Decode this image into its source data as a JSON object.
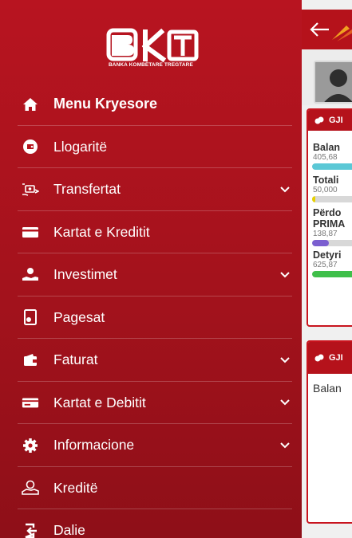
{
  "brand": {
    "caption": "BANKA KOMBËTARE TREGTARE"
  },
  "menu": {
    "items": [
      {
        "label": "Menu Kryesore",
        "icon": "home-icon",
        "expandable": false
      },
      {
        "label": "Llogaritë",
        "icon": "wallet-icon",
        "expandable": false
      },
      {
        "label": "Transfertat",
        "icon": "transfer-icon",
        "expandable": true
      },
      {
        "label": "Kartat e Kreditit",
        "icon": "credit-card-icon",
        "expandable": false
      },
      {
        "label": "Investimet",
        "icon": "investment-icon",
        "expandable": true
      },
      {
        "label": "Pagesat",
        "icon": "payment-icon",
        "expandable": false
      },
      {
        "label": "Faturat",
        "icon": "bill-wallet-icon",
        "expandable": true
      },
      {
        "label": "Kartat e Debitit",
        "icon": "debit-card-icon",
        "expandable": true
      },
      {
        "label": "Informacione",
        "icon": "gear-icon",
        "expandable": true
      },
      {
        "label": "Kreditë",
        "icon": "loan-hand-icon",
        "expandable": false
      },
      {
        "label": "Dalie",
        "icon": "logout-icon",
        "expandable": false
      }
    ]
  },
  "content": {
    "card1": {
      "header": "GJI",
      "rows": [
        {
          "title": "Balan",
          "value": "405,68",
          "fill": 0.85,
          "color": "#5bc8d6"
        },
        {
          "title": "Totali",
          "value": "50,000",
          "fill": 0.06,
          "color": "#e8d100"
        },
        {
          "title": "Përdo",
          "title2": "PRIMA",
          "value": "138,87",
          "fill": 0.3,
          "color": "#7b5fd0"
        },
        {
          "title": "Detyri",
          "value": "625,87",
          "fill": 1.0,
          "color": "#3fbf4a"
        }
      ]
    },
    "card2": {
      "header": "GJI",
      "body": "Balan"
    }
  }
}
